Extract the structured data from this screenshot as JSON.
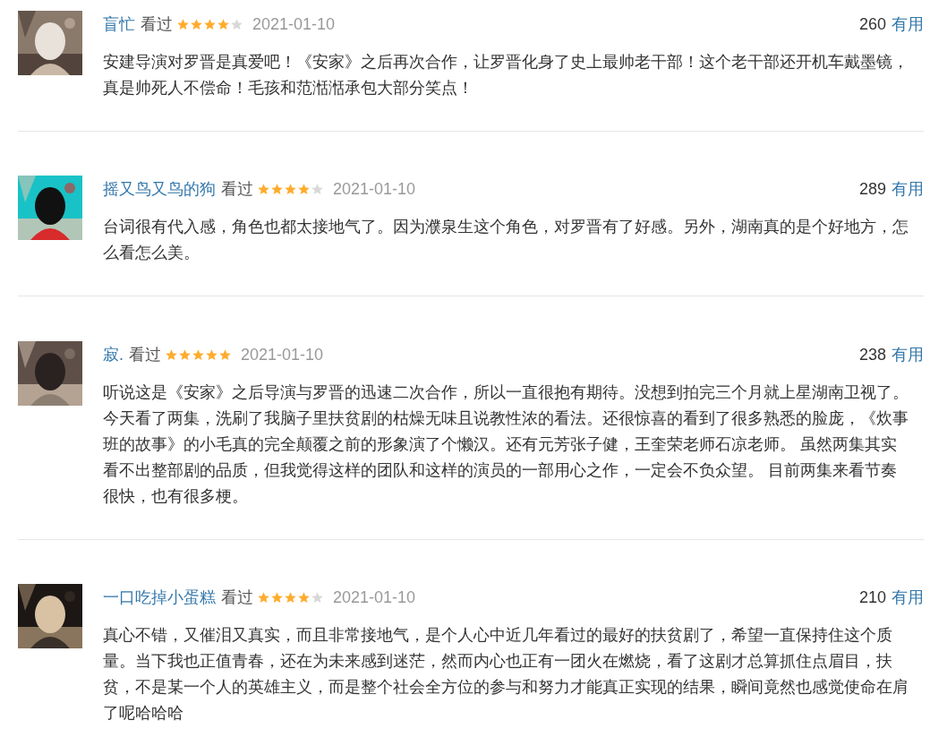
{
  "reviews": [
    {
      "user": "盲忙",
      "status": "看过",
      "stars": 4,
      "date": "2021-01-10",
      "votes": "260",
      "vote_label": "有用",
      "text": "安建导演对罗晋是真爱吧！《安家》之后再次合作，让罗晋化身了史上最帅老干部！这个老干部还开机车戴墨镜，真是帅死人不偿命！毛孩和范湉湉承包大部分笑点！"
    },
    {
      "user": "摇又鸟又鸟的狗",
      "status": "看过",
      "stars": 4,
      "date": "2021-01-10",
      "votes": "289",
      "vote_label": "有用",
      "text": "台词很有代入感，角色也都太接地气了。因为濮泉生这个角色，对罗晋有了好感。另外，湖南真的是个好地方，怎么看怎么美。"
    },
    {
      "user": "寂.",
      "status": "看过",
      "stars": 5,
      "date": "2021-01-10",
      "votes": "238",
      "vote_label": "有用",
      "text": "听说这是《安家》之后导演与罗晋的迅速二次合作，所以一直很抱有期待。没想到拍完三个月就上星湖南卫视了。今天看了两集，洗刷了我脑子里扶贫剧的枯燥无味且说教性浓的看法。还很惊喜的看到了很多熟悉的脸庞，《炊事班的故事》的小毛真的完全颠覆之前的形象演了个懒汉。还有元芳张子健，王奎荣老师石凉老师。 虽然两集其实看不出整部剧的品质，但我觉得这样的团队和这样的演员的一部用心之作，一定会不负众望。 目前两集来看节奏很快，也有很多梗。"
    },
    {
      "user": "一口吃掉小蛋糕",
      "status": "看过",
      "stars": 4,
      "date": "2021-01-10",
      "votes": "210",
      "vote_label": "有用",
      "text": "真心不错，又催泪又真实，而且非常接地气，是个人心中近几年看过的最好的扶贫剧了，希望一直保持住这个质量。当下我也正值青春，还在为未来感到迷茫，然而内心也正有一团火在燃烧，看了这剧才总算抓住点眉目，扶贫，不是某一个人的英雄主义，而是整个社会全方位的参与和努力才能真正实现的结果，瞬间竟然也感觉使命在肩了呢哈哈哈"
    }
  ]
}
